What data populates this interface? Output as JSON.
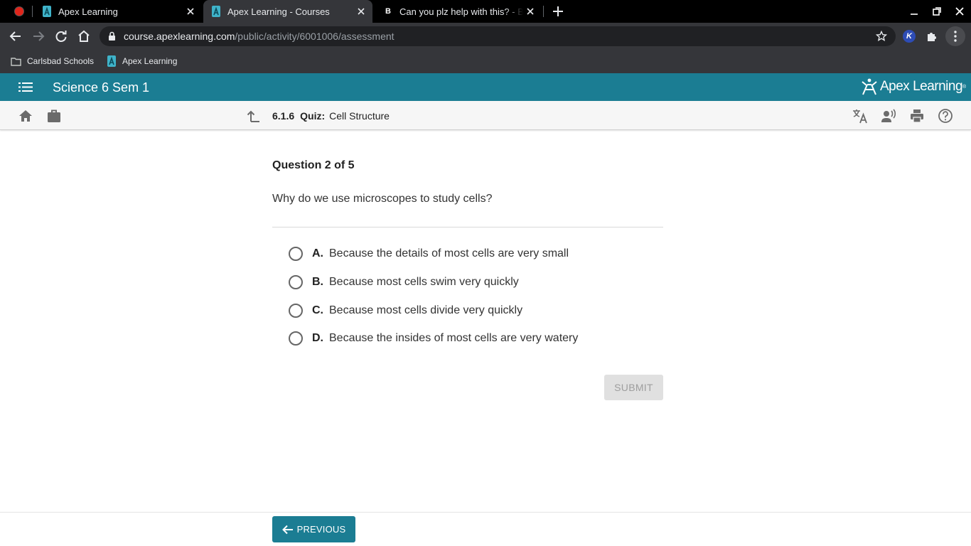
{
  "browser": {
    "tabs": [
      {
        "title": "Apex Learning"
      },
      {
        "title": "Apex Learning - Courses"
      },
      {
        "title": "Can you plz help with this? - Brainly"
      }
    ],
    "address": {
      "host": "course.apexlearning.com",
      "path": "/public/activity/6001006/assessment"
    },
    "extension_k_label": "K",
    "bookmarks": [
      {
        "label": "Carlsbad Schools",
        "icon": "folder-icon"
      },
      {
        "label": "Apex Learning",
        "icon": "apex-favicon"
      }
    ]
  },
  "app": {
    "course_title": "Science 6 Sem 1",
    "brand_name": "Apex Learning",
    "brand_tm": "®",
    "accent_color": "#1b7d93"
  },
  "activity": {
    "number": "6.1.6",
    "kind": "Quiz:",
    "name": "Cell Structure"
  },
  "question": {
    "heading": "Question 2 of 5",
    "prompt": "Why do we use microscopes to study cells?",
    "options": [
      {
        "letter": "A.",
        "text": "Because the details of most cells are very small"
      },
      {
        "letter": "B.",
        "text": "Because most cells swim very quickly"
      },
      {
        "letter": "C.",
        "text": "Because most cells divide very quickly"
      },
      {
        "letter": "D.",
        "text": "Because the insides of most cells are very watery"
      }
    ]
  },
  "buttons": {
    "submit": "SUBMIT",
    "previous": "PREVIOUS"
  }
}
